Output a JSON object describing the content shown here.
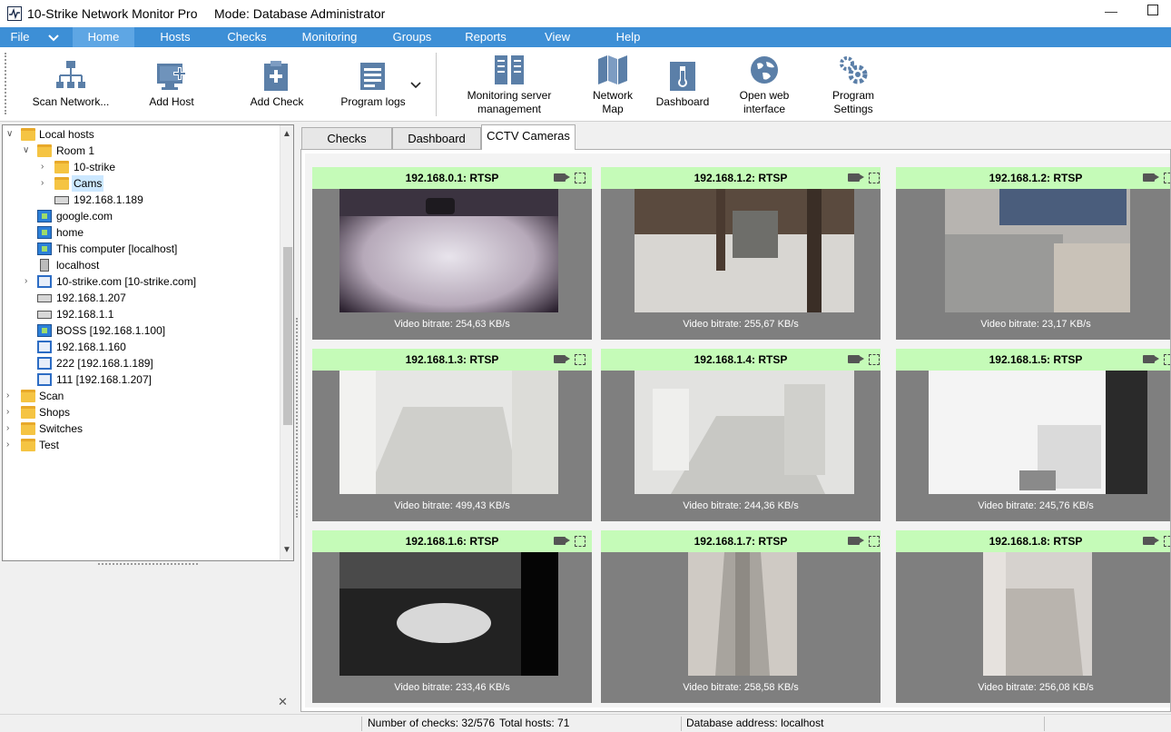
{
  "window": {
    "title": "10-Strike Network Monitor Pro",
    "mode": "Mode: Database Administrator",
    "minimize": "—"
  },
  "menu": {
    "items": [
      "File",
      "Home",
      "Hosts",
      "Checks",
      "Monitoring",
      "Groups",
      "Reports",
      "View",
      "Help"
    ],
    "active": "Home",
    "accent_color": "#3d8fd6"
  },
  "ribbon": {
    "scan_network": "Scan Network...",
    "add_host": "Add Host",
    "add_check": "Add Check",
    "program_logs": "Program logs",
    "monitoring_server_1": "Monitoring server",
    "monitoring_server_2": "management",
    "network_map_1": "Network",
    "network_map_2": "Map",
    "dashboard": "Dashboard",
    "open_web_1": "Open web",
    "open_web_2": "interface",
    "program_settings_1": "Program",
    "program_settings_2": "Settings"
  },
  "tree": {
    "local_hosts": "Local hosts",
    "room1": "Room 1",
    "strike10": "10-strike",
    "cams": "Cams",
    "ip189": "192.168.1.189",
    "google": "google.com",
    "home": "home",
    "this_computer": "This computer [localhost]",
    "localhost": "localhost",
    "strike_com": "10-strike.com [10-strike.com]",
    "ip207": "192.168.1.207",
    "ip1": "192.168.1.1",
    "boss": "BOSS [192.168.1.100]",
    "ip160": "192.168.1.160",
    "h222": "222 [192.168.1.189]",
    "h111": "111 [192.168.1.207]",
    "scan": "Scan",
    "shops": "Shops",
    "switches": "Switches",
    "test": "Test"
  },
  "tabs": {
    "checks": "Checks",
    "dashboard": "Dashboard",
    "cctv": "CCTV Cameras"
  },
  "cameras": [
    {
      "title": "192.168.0.1:  RTSP",
      "bitrate": "Video bitrate: 254,63 KB/s"
    },
    {
      "title": "192.168.1.2:  RTSP",
      "bitrate": "Video bitrate: 255,67 KB/s"
    },
    {
      "title": "192.168.1.2:  RTSP",
      "bitrate": "Video bitrate: 23,17 KB/s"
    },
    {
      "title": "192.168.1.3:  RTSP",
      "bitrate": "Video bitrate: 499,43 KB/s"
    },
    {
      "title": "192.168.1.4:  RTSP",
      "bitrate": "Video bitrate: 244,36 KB/s"
    },
    {
      "title": "192.168.1.5:  RTSP",
      "bitrate": "Video bitrate: 245,76 KB/s"
    },
    {
      "title": "192.168.1.6:  RTSP",
      "bitrate": "Video bitrate: 233,46 KB/s"
    },
    {
      "title": "192.168.1.7:  RTSP",
      "bitrate": "Video bitrate: 258,58 KB/s"
    },
    {
      "title": "192.168.1.8:  RTSP",
      "bitrate": "Video bitrate: 256,08 KB/s"
    }
  ],
  "status": {
    "checks": "Number of checks: 32/576",
    "hosts": "Total hosts: 71",
    "db": "Database address: localhost"
  },
  "colors": {
    "camera_header": "#c5fbb8",
    "camera_panel": "#7f7f7f"
  }
}
